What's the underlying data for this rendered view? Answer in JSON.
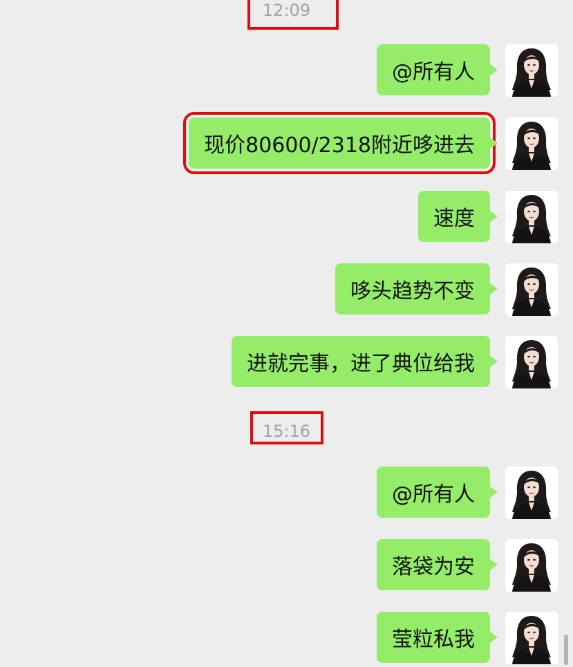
{
  "timestamps": [
    "12:09",
    "15:16"
  ],
  "messages": [
    {
      "text": "@所有人"
    },
    {
      "text": "现价80600/2318附近哆进去"
    },
    {
      "text": "速度"
    },
    {
      "text": "哆头趋势不变"
    },
    {
      "text": "进就完事，进了典位给我"
    },
    {
      "text": "@所有人"
    },
    {
      "text": "落袋为安"
    },
    {
      "text": "莹粒私我"
    }
  ],
  "colors": {
    "background": "#ededed",
    "bubble": "#95ec69",
    "highlight": "#e00b0b",
    "timestamp": "#a3a3a3"
  },
  "icons": {
    "avatar": "woman-portrait-avatar"
  }
}
